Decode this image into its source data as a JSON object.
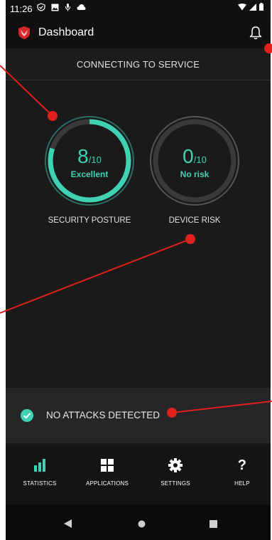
{
  "status_bar": {
    "time": "11:26"
  },
  "app_bar": {
    "title": "Dashboard"
  },
  "banner": {
    "text": "CONNECTING TO SERVICE"
  },
  "security_posture": {
    "score": "8",
    "max": "/10",
    "rating": "Excellent",
    "label": "SECURITY POSTURE",
    "fill_fraction": 0.8
  },
  "device_risk": {
    "score": "0",
    "max": "/10",
    "rating": "No risk",
    "label": "DEVICE RISK",
    "fill_fraction": 0
  },
  "attack_status": {
    "text": "NO ATTACKS DETECTED"
  },
  "bottom_nav": {
    "statistics": "STATISTICS",
    "applications": "APPLICATIONS",
    "settings": "SETTINGS",
    "help": "HELP"
  },
  "colors": {
    "accent": "#3fd1b4",
    "annotation": "#e0201c",
    "background": "#1a1a1a"
  }
}
